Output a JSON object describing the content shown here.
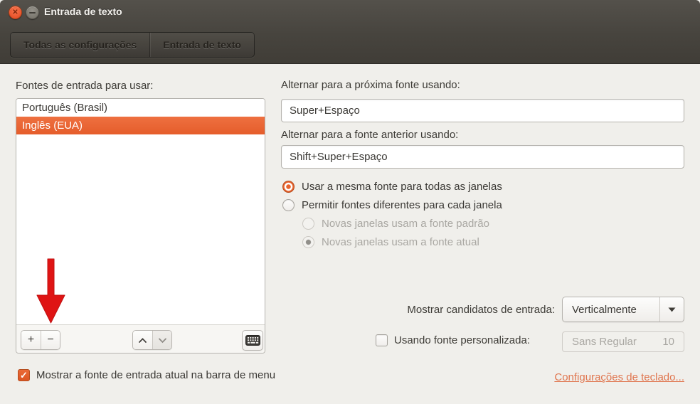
{
  "colors": {
    "accent_orange": "#e8622d",
    "selection_orange": "#e8632f",
    "link_salmon": "#e0764f",
    "header_dark": "#45423c",
    "content_bg": "#f0efeb",
    "annotation_red": "#df1414"
  },
  "window": {
    "title": "Entrada de texto"
  },
  "titlebar_icons": {
    "close_glyph": "✕"
  },
  "toolbar": {
    "all_settings_label": "Todas as configurações",
    "current_panel_label": "Entrada de texto"
  },
  "input_sources": {
    "label": "Fontes de entrada para usar:",
    "items": [
      {
        "label": "Português (Brasil)",
        "selected": false
      },
      {
        "label": "Inglês (EUA)",
        "selected": true
      }
    ],
    "selected_index": 1,
    "toolbar": {
      "add_label": "+",
      "remove_label": "−"
    }
  },
  "shortcuts": {
    "next_label": "Alternar para a próxima fonte usando:",
    "next_value": "Super+Espaço",
    "prev_label": "Alternar para a fonte anterior usando:",
    "prev_value": "Shift+Super+Espaço"
  },
  "font_options": {
    "same_font_label": "Usar a mesma fonte para todas as janelas",
    "same_font_selected": true,
    "different_fonts_label": "Permitir fontes diferentes para cada janela",
    "different_fonts_selected": false,
    "new_windows_default_label": "Novas janelas usam a fonte padrão",
    "new_windows_default_selected": false,
    "new_windows_current_label": "Novas janelas usam a fonte atual",
    "new_windows_current_selected": true
  },
  "candidates": {
    "label": "Mostrar candidatos de entrada:",
    "value": "Verticalmente",
    "arrow_glyph": "▼"
  },
  "custom_font": {
    "label": "Usando fonte personalizada:",
    "checked": false,
    "font_name": "Sans Regular",
    "font_size": "10"
  },
  "footer": {
    "show_in_menubar_label": "Mostrar a fonte de entrada atual na barra de menu",
    "show_in_menubar_checked": true,
    "check_glyph": "✓",
    "keyboard_settings_link": "Configurações de teclado..."
  },
  "annotation": {
    "target": "remove-input-source-button"
  }
}
